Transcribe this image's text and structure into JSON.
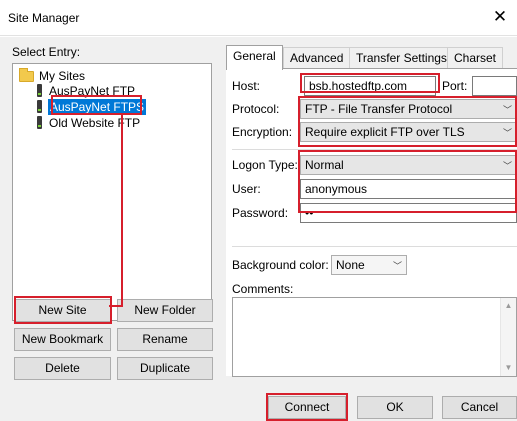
{
  "window": {
    "title": "Site Manager",
    "close_glyph": "✕"
  },
  "select_entry_label": "Select Entry:",
  "tree": {
    "root_label": "My Sites",
    "items": [
      {
        "label": "AusPayNet FTP"
      },
      {
        "label": "AusPayNet FTPS",
        "selected": true
      },
      {
        "label": "Old Website FTP"
      }
    ]
  },
  "left_buttons": {
    "new_site": "New Site",
    "new_folder": "New Folder",
    "new_bookmark": "New Bookmark",
    "rename": "Rename",
    "delete": "Delete",
    "duplicate": "Duplicate"
  },
  "tabs": [
    "General",
    "Advanced",
    "Transfer Settings",
    "Charset"
  ],
  "general": {
    "host_label": "Host:",
    "host_value": "bsb.hostedftp.com",
    "port_label": "Port:",
    "port_value": "",
    "protocol_label": "Protocol:",
    "protocol_value": "FTP - File Transfer Protocol",
    "encryption_label": "Encryption:",
    "encryption_value": "Require explicit FTP over TLS",
    "logon_type_label": "Logon Type:",
    "logon_type_value": "Normal",
    "user_label": "User:",
    "user_value": "anonymous",
    "password_label": "Password:",
    "password_value": "••",
    "background_color_label": "Background color:",
    "background_color_value": "None",
    "comments_label": "Comments:",
    "comments_value": ""
  },
  "bottom_buttons": {
    "connect": "Connect",
    "ok": "OK",
    "cancel": "Cancel"
  },
  "colors": {
    "highlight": "#d61f2c",
    "selection": "#0078d7",
    "window_bg": "#f0f0f0"
  }
}
